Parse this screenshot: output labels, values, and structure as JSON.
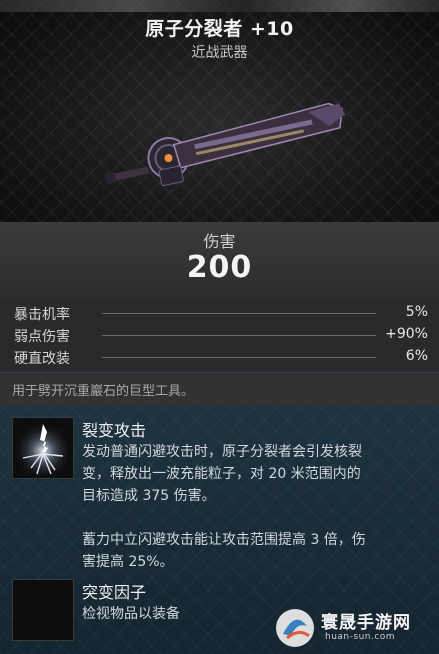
{
  "item": {
    "name": "原子分裂者 +10",
    "type": "近战武器"
  },
  "damage": {
    "label": "伤害",
    "value": "200"
  },
  "stats": [
    {
      "label": "暴击机率",
      "value": "5%"
    },
    {
      "label": "弱点伤害",
      "value": "+90%"
    },
    {
      "label": "硬直改装",
      "value": "6%"
    }
  ],
  "description": "用于劈开沉重巖石的巨型工具。",
  "perks": [
    {
      "title": "裂变攻击",
      "desc_lines": [
        "发动普通闪避攻击时，原子分裂者会引发核裂",
        "变，释放出一波充能粒子，对 20 米范围内的",
        "目标造成 375 伤害。",
        "",
        "蓄力中立闪避攻击能让攻击范围提高 3 倍，伤",
        "害提高 25%。"
      ],
      "icon": "lightning-fission-icon"
    },
    {
      "title": "突变因子",
      "desc_lines": [
        "检视物品以装备"
      ],
      "icon": "empty-mod-slot-icon"
    }
  ],
  "watermark": {
    "name": "寰晟手游网",
    "url": "huan-sun.com"
  },
  "colors": {
    "perk_panel": "#1b2e3a",
    "stats_bg": "#2a2a2c",
    "accent_purple": "#7a5c9a"
  }
}
